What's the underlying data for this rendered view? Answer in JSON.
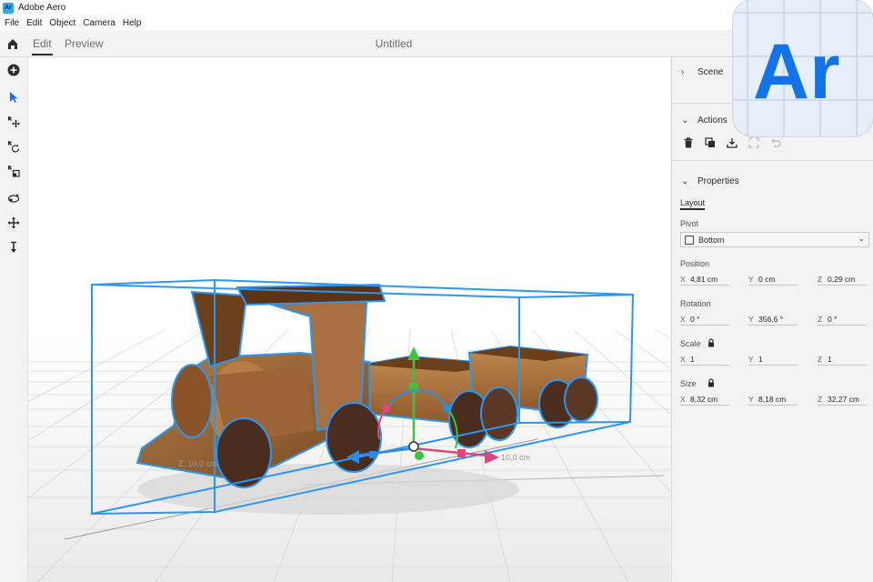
{
  "window": {
    "app_icon_text": "Ar",
    "title": "Adobe Aero"
  },
  "menu": [
    "File",
    "Edit",
    "Object",
    "Camera",
    "Help"
  ],
  "tabs": {
    "edit": "Edit",
    "preview": "Preview"
  },
  "document_title": "Untitled",
  "viewport": {
    "axis_labels": {
      "z": "Z: 10,0 cm",
      "x": "10,0 cm"
    }
  },
  "panel": {
    "scene_label": "Scene",
    "actions_label": "Actions",
    "properties_label": "Properties",
    "layout_tab": "Layout",
    "pivot": {
      "label": "Pivot",
      "value": "Bottom"
    },
    "position": {
      "label": "Position",
      "x": "4,81 cm",
      "y": "0 cm",
      "z": "0,29 cm"
    },
    "rotation": {
      "label": "Rotation",
      "x": "0 °",
      "y": "356,6 °",
      "z": "0 °"
    },
    "scale": {
      "label": "Scale",
      "x": "1",
      "y": "1",
      "z": "1"
    },
    "size": {
      "label": "Size",
      "x": "8,32 cm",
      "y": "8,18 cm",
      "z": "32,27 cm"
    },
    "axis_letters": {
      "x": "X",
      "y": "Y",
      "z": "Z"
    }
  },
  "logo": {
    "text": "Ar",
    "color": "#1473e6"
  },
  "colors": {
    "selection": "#2d96f0",
    "gizmo_y": "#3cc53c",
    "gizmo_x": "#e0457b",
    "gizmo_z": "#2f8be0",
    "accent": "#1473e6"
  }
}
